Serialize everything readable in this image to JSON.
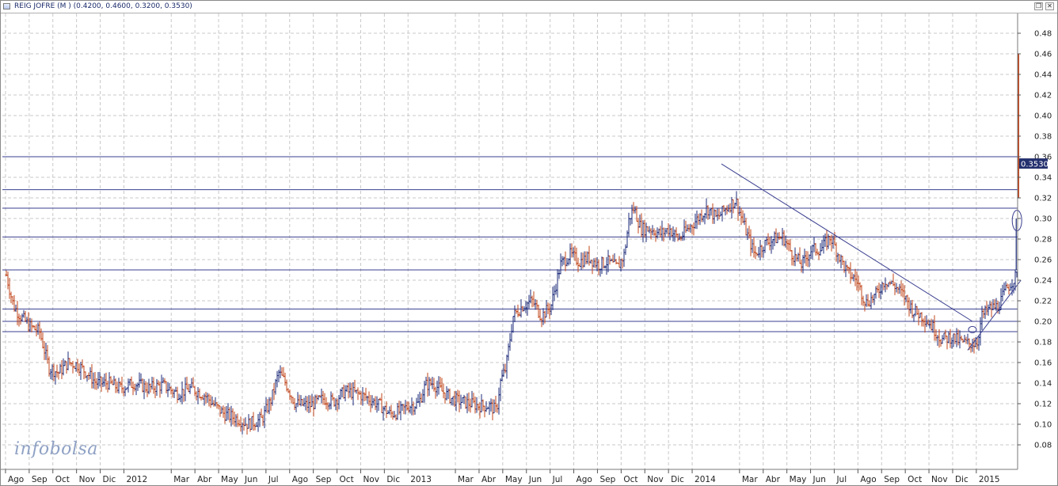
{
  "window": {
    "title": "REIG JOFRE (M ) (0.4200, 0.4600, 0.3200, 0.3530)",
    "icon": "chart-window-icon",
    "buttons": [
      "restore-icon",
      "close-icon"
    ]
  },
  "watermark": {
    "prefix": "info",
    "suffix": "bolsa"
  },
  "colors": {
    "up": "#1d2b7a",
    "down": "#c0441a",
    "grid": "#c8c8c8",
    "line": "#3a3f8f",
    "label_bg": "#24306e"
  },
  "chart_data": {
    "type": "ohlc",
    "ylim": [
      0.06,
      0.49
    ],
    "yticks": [
      0.08,
      0.1,
      0.12,
      0.14,
      0.16,
      0.18,
      0.2,
      0.22,
      0.24,
      0.26,
      0.28,
      0.3,
      0.32,
      0.34,
      0.36,
      0.38,
      0.4,
      0.42,
      0.44,
      0.46,
      0.48
    ],
    "ytick_labels": [
      "0.08",
      "0.10",
      "0.12",
      "0.14",
      "0.16",
      "0.18",
      "0.20",
      "0.22",
      "0.24",
      "0.26",
      "0.28",
      "0.30",
      "0.32",
      "0.34",
      "0.36",
      "0.38",
      "0.40",
      "0.42",
      "0.44",
      "0.46",
      "0.48"
    ],
    "grid": true,
    "xlim": [
      0,
      42.75
    ],
    "xticks": [
      {
        "label": "Ago",
        "t": 0.5
      },
      {
        "label": "Sep",
        "t": 1.5
      },
      {
        "label": "Oct",
        "t": 2.5
      },
      {
        "label": "Nov",
        "t": 3.5
      },
      {
        "label": "Dic",
        "t": 4.5
      },
      {
        "label": "2012",
        "t": 5.5
      },
      {
        "label": "Mar",
        "t": 7.5
      },
      {
        "label": "Abr",
        "t": 8.5
      },
      {
        "label": "May",
        "t": 9.5
      },
      {
        "label": "Jun",
        "t": 10.5
      },
      {
        "label": "Jul",
        "t": 11.5
      },
      {
        "label": "Ago",
        "t": 12.5
      },
      {
        "label": "Sep",
        "t": 13.5
      },
      {
        "label": "Oct",
        "t": 14.5
      },
      {
        "label": "Nov",
        "t": 15.5
      },
      {
        "label": "Dic",
        "t": 16.5
      },
      {
        "label": "2013",
        "t": 17.5
      },
      {
        "label": "Mar",
        "t": 19.5
      },
      {
        "label": "Abr",
        "t": 20.5
      },
      {
        "label": "May",
        "t": 21.5
      },
      {
        "label": "Jun",
        "t": 22.5
      },
      {
        "label": "Jul",
        "t": 23.5
      },
      {
        "label": "Ago",
        "t": 24.5
      },
      {
        "label": "Sep",
        "t": 25.5
      },
      {
        "label": "Oct",
        "t": 26.5
      },
      {
        "label": "Nov",
        "t": 27.5
      },
      {
        "label": "Dic",
        "t": 28.5
      },
      {
        "label": "2014",
        "t": 29.5
      },
      {
        "label": "Mar",
        "t": 31.5
      },
      {
        "label": "Abr",
        "t": 32.5
      },
      {
        "label": "May",
        "t": 33.5
      },
      {
        "label": "Jun",
        "t": 34.5
      },
      {
        "label": "Jul",
        "t": 35.5
      },
      {
        "label": "Ago",
        "t": 36.5
      },
      {
        "label": "Sep",
        "t": 37.5
      },
      {
        "label": "Oct",
        "t": 38.5
      },
      {
        "label": "Nov",
        "t": 39.5
      },
      {
        "label": "Dic",
        "t": 40.5
      },
      {
        "label": "2015",
        "t": 41.5
      }
    ],
    "price_path": [
      [
        0.0,
        0.245
      ],
      [
        0.3,
        0.215
      ],
      [
        0.6,
        0.205
      ],
      [
        1.0,
        0.195
      ],
      [
        1.4,
        0.19
      ],
      [
        1.8,
        0.155
      ],
      [
        2.2,
        0.15
      ],
      [
        2.6,
        0.16
      ],
      [
        3.0,
        0.158
      ],
      [
        3.4,
        0.15
      ],
      [
        3.8,
        0.14
      ],
      [
        4.3,
        0.14
      ],
      [
        4.8,
        0.135
      ],
      [
        5.4,
        0.14
      ],
      [
        6.0,
        0.135
      ],
      [
        6.6,
        0.138
      ],
      [
        7.2,
        0.13
      ],
      [
        7.8,
        0.135
      ],
      [
        8.4,
        0.128
      ],
      [
        8.8,
        0.118
      ],
      [
        9.2,
        0.11
      ],
      [
        9.8,
        0.105
      ],
      [
        10.2,
        0.1
      ],
      [
        10.8,
        0.105
      ],
      [
        11.2,
        0.125
      ],
      [
        11.5,
        0.15
      ],
      [
        11.8,
        0.14
      ],
      [
        12.2,
        0.12
      ],
      [
        12.8,
        0.118
      ],
      [
        13.4,
        0.125
      ],
      [
        13.8,
        0.122
      ],
      [
        14.3,
        0.132
      ],
      [
        14.8,
        0.13
      ],
      [
        15.3,
        0.125
      ],
      [
        15.8,
        0.118
      ],
      [
        16.2,
        0.11
      ],
      [
        16.6,
        0.112
      ],
      [
        17.0,
        0.118
      ],
      [
        17.4,
        0.12
      ],
      [
        17.7,
        0.138
      ],
      [
        18.0,
        0.14
      ],
      [
        18.4,
        0.132
      ],
      [
        18.8,
        0.125
      ],
      [
        19.2,
        0.122
      ],
      [
        19.6,
        0.12
      ],
      [
        20.0,
        0.118
      ],
      [
        20.4,
        0.118
      ],
      [
        20.7,
        0.113
      ],
      [
        20.85,
        0.14
      ],
      [
        21.1,
        0.155
      ],
      [
        21.4,
        0.205
      ],
      [
        21.8,
        0.215
      ],
      [
        22.2,
        0.22
      ],
      [
        22.6,
        0.205
      ],
      [
        23.0,
        0.215
      ],
      [
        23.4,
        0.255
      ],
      [
        23.8,
        0.265
      ],
      [
        24.2,
        0.258
      ],
      [
        24.6,
        0.262
      ],
      [
        25.0,
        0.255
      ],
      [
        25.4,
        0.258
      ],
      [
        25.8,
        0.252
      ],
      [
        26.1,
        0.265
      ],
      [
        26.3,
        0.3
      ],
      [
        26.5,
        0.31
      ],
      [
        26.8,
        0.29
      ],
      [
        27.2,
        0.29
      ],
      [
        27.6,
        0.285
      ],
      [
        28.0,
        0.29
      ],
      [
        28.4,
        0.28
      ],
      [
        28.8,
        0.29
      ],
      [
        29.2,
        0.3
      ],
      [
        29.6,
        0.31
      ],
      [
        30.0,
        0.3
      ],
      [
        30.4,
        0.31
      ],
      [
        30.8,
        0.318
      ],
      [
        31.2,
        0.29
      ],
      [
        31.6,
        0.265
      ],
      [
        32.0,
        0.275
      ],
      [
        32.4,
        0.28
      ],
      [
        32.8,
        0.282
      ],
      [
        33.2,
        0.265
      ],
      [
        33.6,
        0.255
      ],
      [
        34.0,
        0.27
      ],
      [
        34.4,
        0.27
      ],
      [
        34.8,
        0.282
      ],
      [
        35.2,
        0.262
      ],
      [
        35.5,
        0.248
      ],
      [
        35.9,
        0.24
      ],
      [
        36.3,
        0.218
      ],
      [
        36.7,
        0.225
      ],
      [
        37.1,
        0.24
      ],
      [
        37.5,
        0.235
      ],
      [
        37.9,
        0.225
      ],
      [
        38.3,
        0.21
      ],
      [
        38.7,
        0.205
      ],
      [
        39.1,
        0.195
      ],
      [
        39.5,
        0.182
      ],
      [
        39.9,
        0.185
      ],
      [
        40.3,
        0.18
      ],
      [
        40.7,
        0.178
      ],
      [
        41.0,
        0.18
      ],
      [
        41.2,
        0.205
      ],
      [
        41.5,
        0.212
      ],
      [
        41.9,
        0.215
      ],
      [
        42.2,
        0.23
      ],
      [
        42.5,
        0.24
      ],
      [
        42.7,
        0.245
      ]
    ],
    "final_bar": {
      "t": 42.75,
      "open": 0.42,
      "high": 0.46,
      "low": 0.32,
      "close": 0.353
    },
    "last_price_label": "0.3530",
    "horizontal_lines": [
      0.36,
      0.328,
      0.31,
      0.282,
      0.25,
      0.212,
      0.2,
      0.19
    ],
    "trend_lines": [
      {
        "from": [
          30.2,
          0.353
        ],
        "to": [
          40.8,
          0.2
        ]
      },
      {
        "from": [
          40.6,
          0.172
        ],
        "to": [
          42.85,
          0.24
        ]
      }
    ],
    "markers": [
      {
        "t": 42.85,
        "value": 0.298
      },
      {
        "t": 40.8,
        "value": 0.192
      }
    ]
  }
}
